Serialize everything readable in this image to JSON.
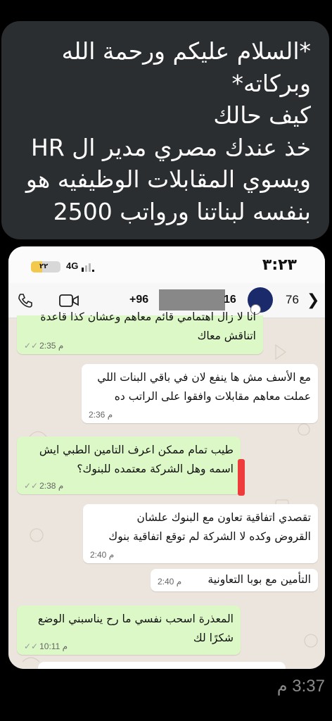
{
  "top_message": {
    "lines": [
      "*السلام عليكم ورحمة الله",
      "وبركاته*",
      "كيف حالك",
      "خذ عندك مصري مدير ال HR",
      "ويسوي المقابلات الوظيفيه هو",
      "بنفسه لبناتنا ورواتب 2500"
    ]
  },
  "screenshot": {
    "statusbar": {
      "battery": "٢٢",
      "network": "4G",
      "clock": "٣:٢٣"
    },
    "header": {
      "number_start": "+96",
      "number_end": "16",
      "unread_count": "76",
      "back_chevron": "❯",
      "icons": [
        "phone-icon",
        "video-icon",
        "avatar",
        "chevron-right-icon"
      ]
    },
    "messages": [
      {
        "dir": "out",
        "text": [
          "انا لا زال اهتمامي قائم معاهم وعشان كذا قاعدة",
          "اتناقش معاك"
        ],
        "time": "2:35 م"
      },
      {
        "dir": "in",
        "text": [
          "مع الأسف مش ها ينفع لان في باقي البنات اللي",
          "عملت معاهم مقابلات وافقوا على الراتب ده"
        ],
        "time": "2:36 م"
      },
      {
        "dir": "out",
        "text": [
          "طيب تمام ممكن اعرف التامين الطبي ايش",
          "اسمه وهل الشركة معتمده للبنوك؟"
        ],
        "time": "2:38 م"
      },
      {
        "dir": "in",
        "text": [
          "تقصدي اتفاقية تعاون مع البنوك علشان",
          "القروض وكده لا الشركة لم توقع اتفاقية بنوك"
        ],
        "time": "2:40 م"
      },
      {
        "dir": "in",
        "text": [
          "التأمين مع بوبا التعاونية"
        ],
        "time": "2:40 م"
      },
      {
        "dir": "out",
        "text": [
          "المعذرة اسحب نفسي ما رح يناسبني الوضع",
          "شكرًا لك"
        ],
        "time": "10:11 م"
      }
    ],
    "colors": {
      "outgoing": "#dcf8c6",
      "incoming": "#ffffff",
      "wallpaper": "#ece5dd",
      "redmark": "#ef3b3b"
    }
  },
  "outer_timestamp": "3:37 م",
  "colors": {
    "top_bubble": "#2b2e30",
    "background": "#000000"
  }
}
